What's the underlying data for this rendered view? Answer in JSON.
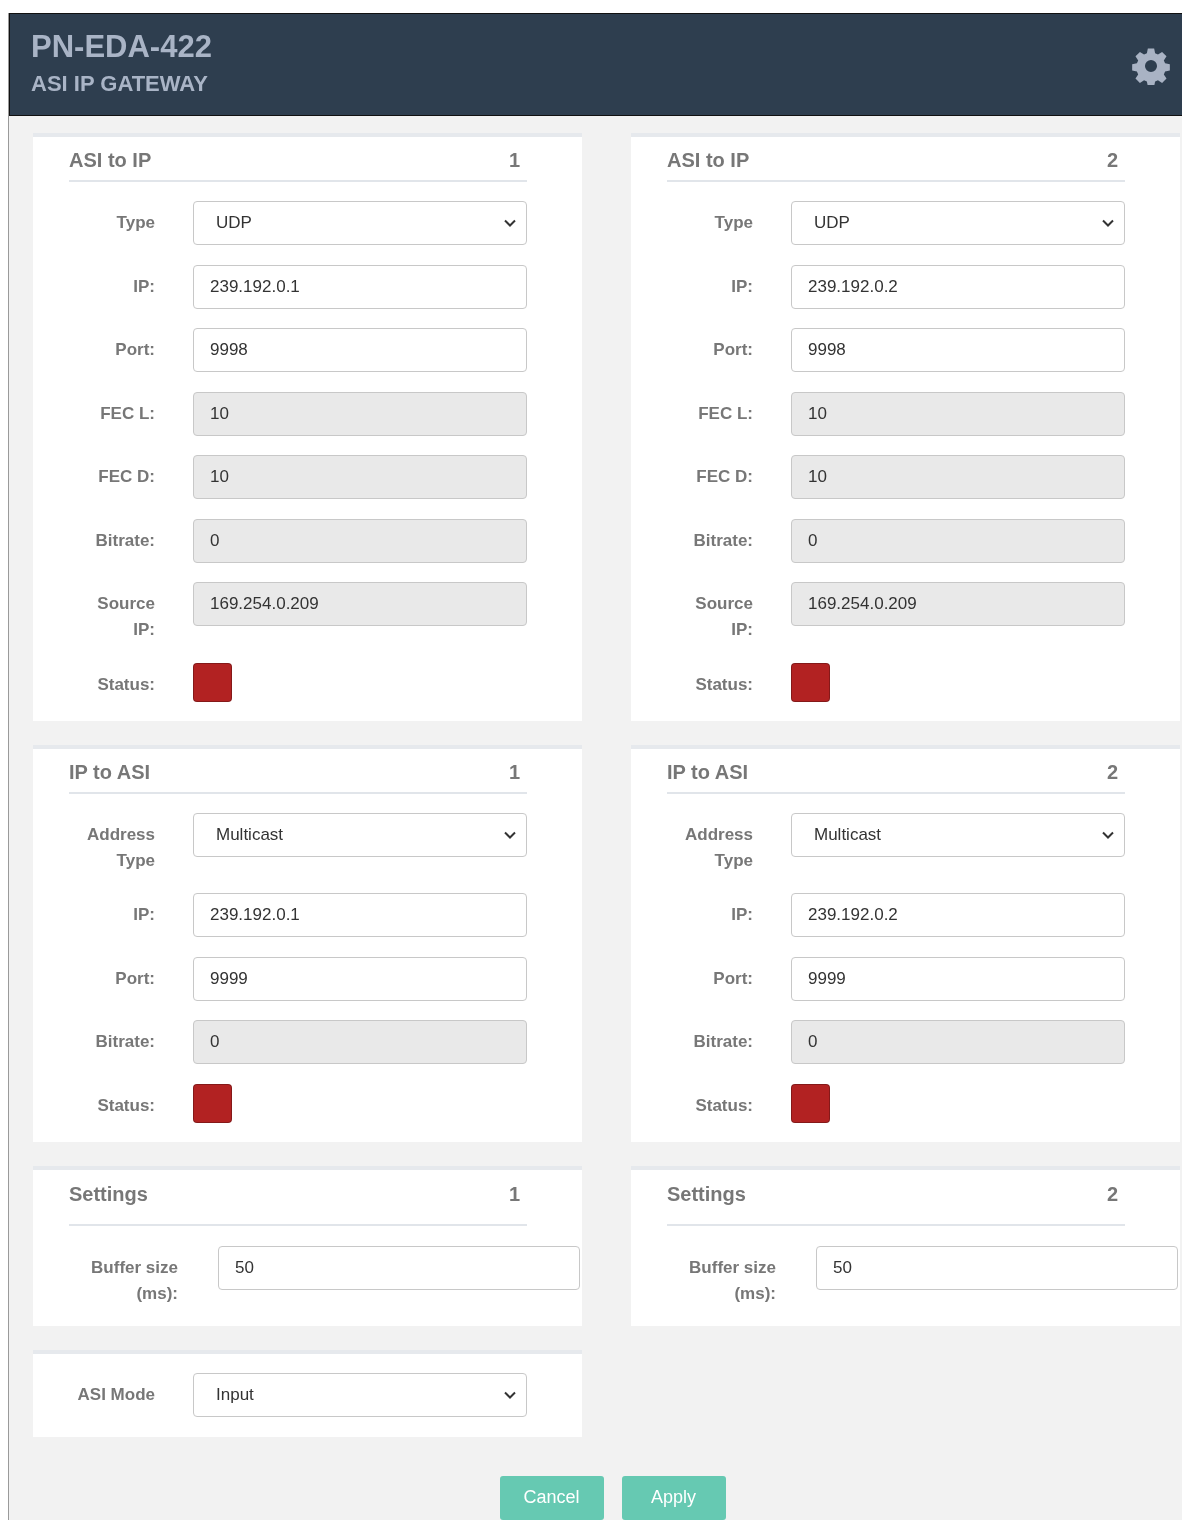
{
  "header": {
    "title": "PN-EDA-422",
    "subtitle": "ASI IP GATEWAY"
  },
  "panels": [
    {
      "kind": "io",
      "title": "ASI to IP",
      "number": "1",
      "fields": [
        {
          "label": "Type",
          "kind": "select",
          "value": "UDP"
        },
        {
          "label": "IP:",
          "kind": "text",
          "value": "239.192.0.1"
        },
        {
          "label": "Port:",
          "kind": "text",
          "value": "9998"
        },
        {
          "label": "FEC L:",
          "kind": "readonly",
          "value": "10"
        },
        {
          "label": "FEC D:",
          "kind": "readonly",
          "value": "10"
        },
        {
          "label": "Bitrate:",
          "kind": "readonly",
          "value": "0"
        },
        {
          "label": "Source IP:",
          "kind": "readonly",
          "value": "169.254.0.209"
        },
        {
          "label": "Status:",
          "kind": "status",
          "color": "#b22222"
        }
      ]
    },
    {
      "kind": "io",
      "title": "ASI to IP",
      "number": "2",
      "fields": [
        {
          "label": "Type",
          "kind": "select",
          "value": "UDP"
        },
        {
          "label": "IP:",
          "kind": "text",
          "value": "239.192.0.2"
        },
        {
          "label": "Port:",
          "kind": "text",
          "value": "9998"
        },
        {
          "label": "FEC L:",
          "kind": "readonly",
          "value": "10"
        },
        {
          "label": "FEC D:",
          "kind": "readonly",
          "value": "10"
        },
        {
          "label": "Bitrate:",
          "kind": "readonly",
          "value": "0"
        },
        {
          "label": "Source IP:",
          "kind": "readonly",
          "value": "169.254.0.209"
        },
        {
          "label": "Status:",
          "kind": "status",
          "color": "#b22222"
        }
      ]
    },
    {
      "kind": "io",
      "title": "IP to ASI",
      "number": "1",
      "fields": [
        {
          "label": "Address Type",
          "kind": "select",
          "value": "Multicast"
        },
        {
          "label": "IP:",
          "kind": "text",
          "value": "239.192.0.1"
        },
        {
          "label": "Port:",
          "kind": "text",
          "value": "9999"
        },
        {
          "label": "Bitrate:",
          "kind": "readonly",
          "value": "0"
        },
        {
          "label": "Status:",
          "kind": "status",
          "color": "#b22222"
        }
      ]
    },
    {
      "kind": "io",
      "title": "IP to ASI",
      "number": "2",
      "fields": [
        {
          "label": "Address Type",
          "kind": "select",
          "value": "Multicast"
        },
        {
          "label": "IP:",
          "kind": "text",
          "value": "239.192.0.2"
        },
        {
          "label": "Port:",
          "kind": "text",
          "value": "9999"
        },
        {
          "label": "Bitrate:",
          "kind": "readonly",
          "value": "0"
        },
        {
          "label": "Status:",
          "kind": "status",
          "color": "#b22222"
        }
      ]
    },
    {
      "kind": "settings",
      "title": "Settings",
      "number": "1",
      "fields": [
        {
          "label": "Buffer size (ms):",
          "kind": "text",
          "value": "50"
        }
      ]
    },
    {
      "kind": "settings",
      "title": "Settings",
      "number": "2",
      "fields": [
        {
          "label": "Buffer size (ms):",
          "kind": "text",
          "value": "50"
        }
      ]
    },
    {
      "kind": "mode",
      "fields": [
        {
          "label": "ASI Mode",
          "kind": "select",
          "value": "Input"
        }
      ]
    }
  ],
  "buttons": [
    {
      "label": "Cancel"
    },
    {
      "label": "Apply"
    }
  ]
}
